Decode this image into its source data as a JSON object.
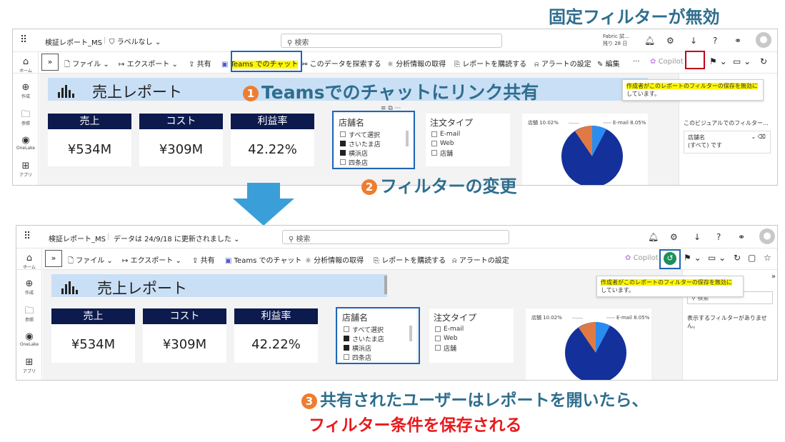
{
  "headline_top": "固定フィルターが無効",
  "step1": {
    "num": "1",
    "text": "Teamsでのチャットにリンク共有"
  },
  "step2": {
    "num": "2",
    "text": "フィルターの変更"
  },
  "step3": {
    "num": "3",
    "line1": "共有されたユーザーはレポートを開いたら、",
    "line2": "フィルター条件を保存される"
  },
  "shot1": {
    "report_name": "検証レポート_MS",
    "label_menu": "ラベルなし",
    "search_placeholder": "検索",
    "fabric_line1": "Fabric 試...",
    "fabric_line2": "残り 28 日",
    "toolbar": {
      "file": "ファイル",
      "export": "エクスポート",
      "share": "共有",
      "teams_chat": "Teams でのチャット",
      "explore": "このデータを探索する",
      "insights": "分析情報の取得",
      "subscribe": "レポートを購読する",
      "alert": "アラートの設定",
      "edit": "編集",
      "more": "···",
      "copilot": "Copilot"
    },
    "nav": {
      "home": "ホーム",
      "create": "作成",
      "browse": "参照",
      "onelake": "OneLake",
      "apps": "アプリ"
    },
    "report_title": "売上レポート",
    "cards": [
      {
        "label": "売上",
        "value": "¥534M"
      },
      {
        "label": "コスト",
        "value": "¥309M"
      },
      {
        "label": "利益率",
        "value": "42.22%"
      }
    ],
    "store_slicer": {
      "title": "店舗名",
      "items": [
        "すべて選択",
        "さいたま店",
        "横浜店",
        "四条店"
      ]
    },
    "order_slicer": {
      "title": "注文タイプ",
      "items": [
        "E-mail",
        "Web",
        "店舗"
      ]
    },
    "pie_labels": {
      "store": "店舗 10.02%",
      "email": "E-mail 8.05%"
    },
    "tooltip_line1": "作成者がこのレポートのフィルターの保存を無効に",
    "tooltip_line2": "しています。",
    "panel": {
      "heading": "このビジュアルでのフィルター...",
      "filter_name": "店舗名",
      "filter_value": "(すべて) です"
    }
  },
  "shot2": {
    "report_name": "検証レポート_MS",
    "updated": "データは 24/9/18 に更新されました",
    "search_placeholder": "検索",
    "toolbar": {
      "file": "ファイル",
      "export": "エクスポート",
      "share": "共有",
      "teams_chat": "Teams でのチャット",
      "insights": "分析情報の取得",
      "subscribe": "レポートを購読する",
      "alert": "アラートの設定",
      "copilot": "Copilot"
    },
    "nav": {
      "home": "ホーム",
      "create": "作成",
      "browse": "参照",
      "onelake": "OneLake",
      "apps": "アプリ"
    },
    "report_title": "売上レポート",
    "cards": [
      {
        "label": "売上",
        "value": "¥534M"
      },
      {
        "label": "コスト",
        "value": "¥309M"
      },
      {
        "label": "利益率",
        "value": "42.22%"
      }
    ],
    "store_slicer": {
      "title": "店舗名",
      "items": [
        "すべて選択",
        "さいたま店",
        "横浜店",
        "四条店"
      ]
    },
    "order_slicer": {
      "title": "注文タイプ",
      "items": [
        "E-mail",
        "Web",
        "店舗"
      ]
    },
    "pie_labels": {
      "store": "店舗 10.02%",
      "email": "E-mail 8.05%"
    },
    "tooltip_line1": "作成者がこのレポートのフィルターの保存を無効に",
    "tooltip_line2": "しています。",
    "panel": {
      "search": "検索",
      "empty_line1": "表示するフィルターがありませ",
      "empty_line2": "ん。"
    }
  },
  "colors": {
    "accent_blue": "#1f66b7",
    "orange": "#ed7d31",
    "red": "#e8191c",
    "headline": "#2e6e8e",
    "card_header": "#0c1a4d",
    "pie_main": "#14309a",
    "pie_store": "#e07a45",
    "pie_email": "#2b8cf0"
  }
}
